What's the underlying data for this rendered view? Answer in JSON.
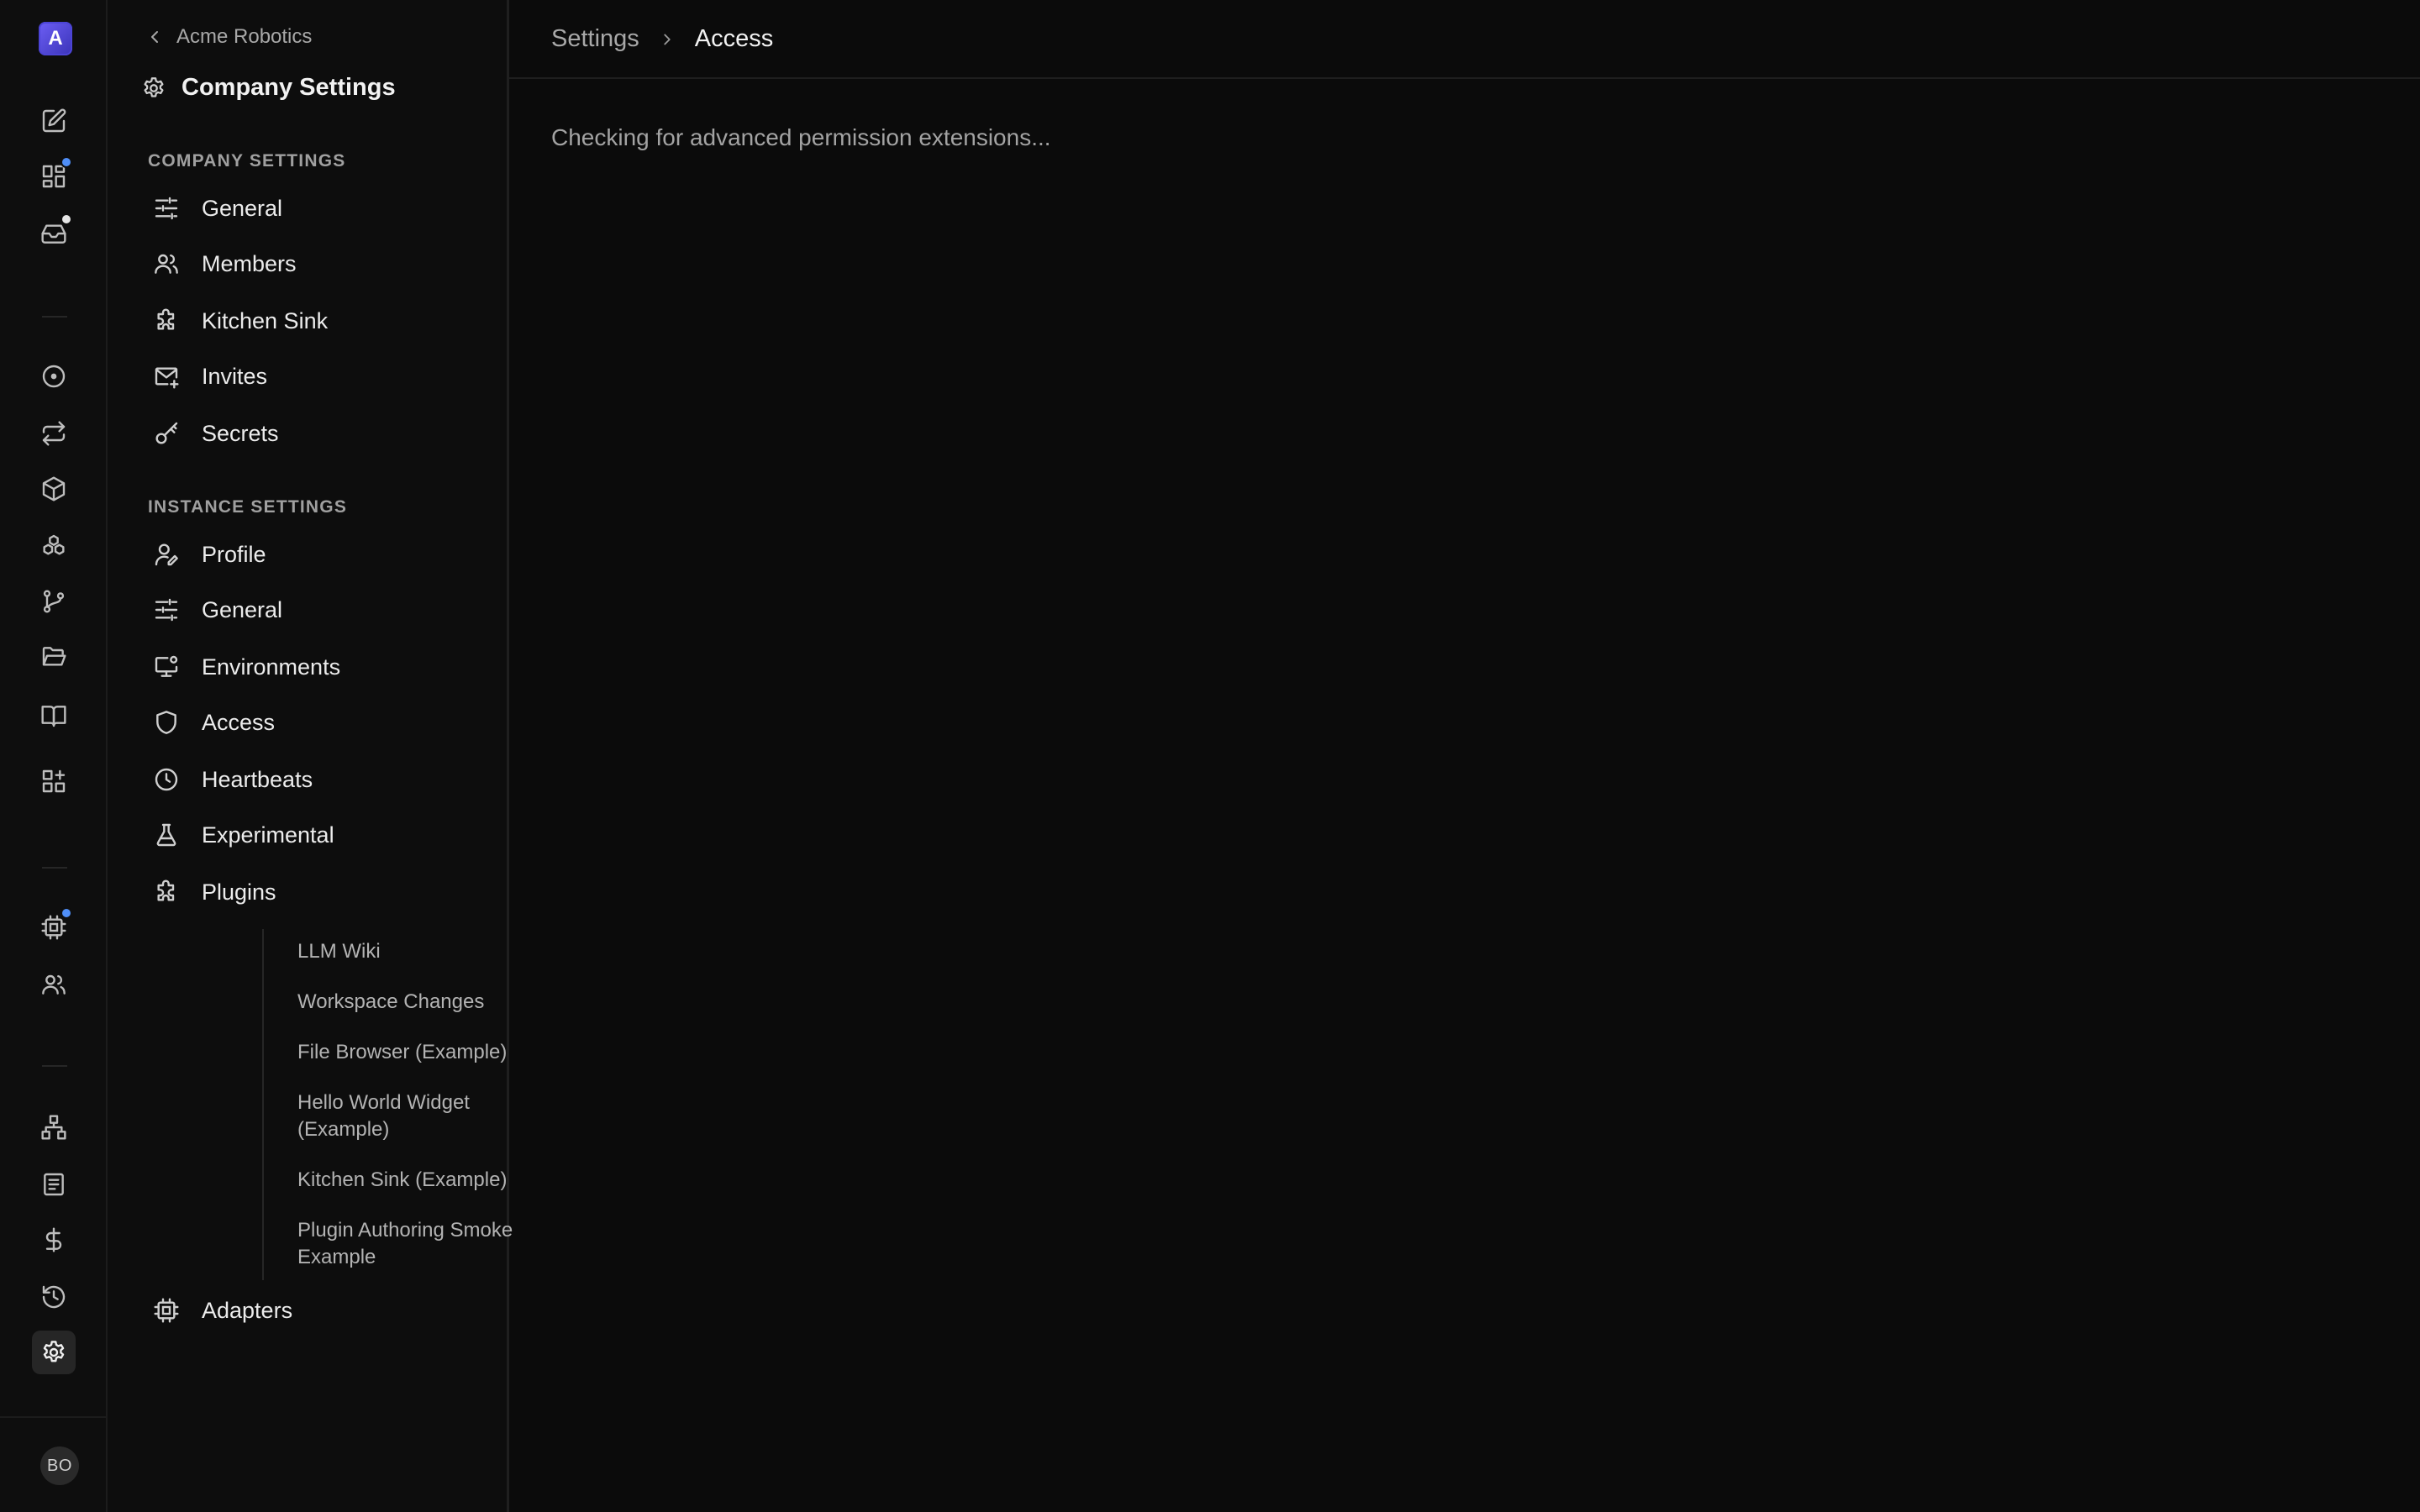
{
  "rail": {
    "company_initial": "A",
    "user_initials": "BO",
    "accent_dot_color": "#4f8ef7",
    "neutral_dot_color": "#e6e6e6"
  },
  "sidebar": {
    "back_label": "Acme Robotics",
    "title": "Company Settings",
    "company_section_label": "Company Settings",
    "company_items": [
      {
        "label": "General",
        "icon": "sliders-icon"
      },
      {
        "label": "Members",
        "icon": "users-icon"
      },
      {
        "label": "Kitchen Sink",
        "icon": "puzzle-icon"
      },
      {
        "label": "Invites",
        "icon": "mail-plus-icon"
      },
      {
        "label": "Secrets",
        "icon": "key-icon"
      }
    ],
    "instance_section_label": "Instance Settings",
    "instance_items": [
      {
        "label": "Profile",
        "icon": "user-pen-icon"
      },
      {
        "label": "General",
        "icon": "sliders-icon"
      },
      {
        "label": "Environments",
        "icon": "monitor-cog-icon"
      },
      {
        "label": "Access",
        "icon": "shield-icon"
      },
      {
        "label": "Heartbeats",
        "icon": "clock-icon"
      },
      {
        "label": "Experimental",
        "icon": "flask-icon"
      },
      {
        "label": "Plugins",
        "icon": "puzzle-icon"
      }
    ],
    "plugin_items": [
      "LLM Wiki",
      "Workspace Changes",
      "File Browser (Example)",
      "Hello World Widget (Example)",
      "Kitchen Sink (Example)",
      "Plugin Authoring Smoke Example"
    ],
    "adapters_label": "Adapters"
  },
  "main": {
    "breadcrumb_parent": "Settings",
    "breadcrumb_current": "Access",
    "status_text": "Checking for advanced permission extensions..."
  }
}
